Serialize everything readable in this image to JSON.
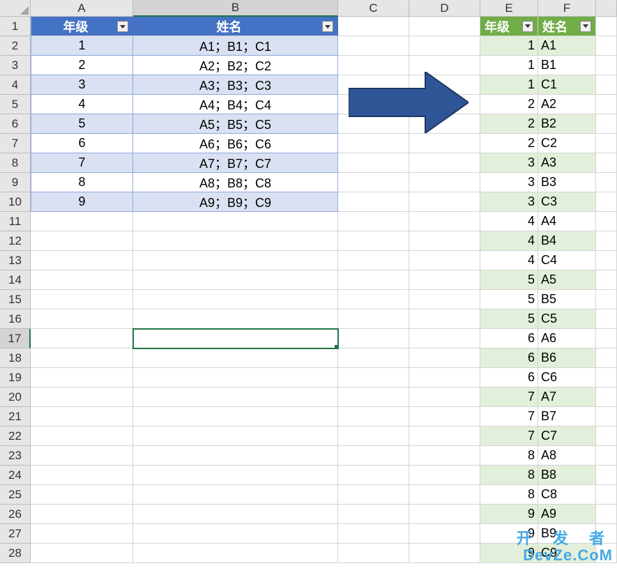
{
  "columns": [
    "A",
    "B",
    "C",
    "D",
    "E",
    "F",
    ""
  ],
  "table1": {
    "headers": [
      "年级",
      "姓名"
    ],
    "rows": [
      {
        "grade": "1",
        "names": "A1；B1；C1"
      },
      {
        "grade": "2",
        "names": "A2；B2；C2"
      },
      {
        "grade": "3",
        "names": "A3；B3；C3"
      },
      {
        "grade": "4",
        "names": "A4；B4；C4"
      },
      {
        "grade": "5",
        "names": "A5；B5；C5"
      },
      {
        "grade": "6",
        "names": "A6；B6；C6"
      },
      {
        "grade": "7",
        "names": "A7；B7；C7"
      },
      {
        "grade": "8",
        "names": "A8；B8；C8"
      },
      {
        "grade": "9",
        "names": "A9；B9；C9"
      }
    ]
  },
  "table2": {
    "headers": [
      "年级",
      "姓名"
    ],
    "rows": [
      {
        "grade": "1",
        "name": "A1"
      },
      {
        "grade": "1",
        "name": "B1"
      },
      {
        "grade": "1",
        "name": "C1"
      },
      {
        "grade": "2",
        "name": "A2"
      },
      {
        "grade": "2",
        "name": "B2"
      },
      {
        "grade": "2",
        "name": "C2"
      },
      {
        "grade": "3",
        "name": "A3"
      },
      {
        "grade": "3",
        "name": "B3"
      },
      {
        "grade": "3",
        "name": "C3"
      },
      {
        "grade": "4",
        "name": "A4"
      },
      {
        "grade": "4",
        "name": "B4"
      },
      {
        "grade": "4",
        "name": "C4"
      },
      {
        "grade": "5",
        "name": "A5"
      },
      {
        "grade": "5",
        "name": "B5"
      },
      {
        "grade": "5",
        "name": "C5"
      },
      {
        "grade": "6",
        "name": "A6"
      },
      {
        "grade": "6",
        "name": "B6"
      },
      {
        "grade": "6",
        "name": "C6"
      },
      {
        "grade": "7",
        "name": "A7"
      },
      {
        "grade": "7",
        "name": "B7"
      },
      {
        "grade": "7",
        "name": "C7"
      },
      {
        "grade": "8",
        "name": "A8"
      },
      {
        "grade": "8",
        "name": "B8"
      },
      {
        "grade": "8",
        "name": "C8"
      },
      {
        "grade": "9",
        "name": "A9"
      },
      {
        "grade": "9",
        "name": "B9"
      },
      {
        "grade": "9",
        "name": "C9"
      }
    ]
  },
  "selected_cell": {
    "row": 17,
    "col": "B"
  },
  "total_rows": 28,
  "watermark": {
    "line1": "开 发 者",
    "line2": "DevZe.CoM"
  }
}
